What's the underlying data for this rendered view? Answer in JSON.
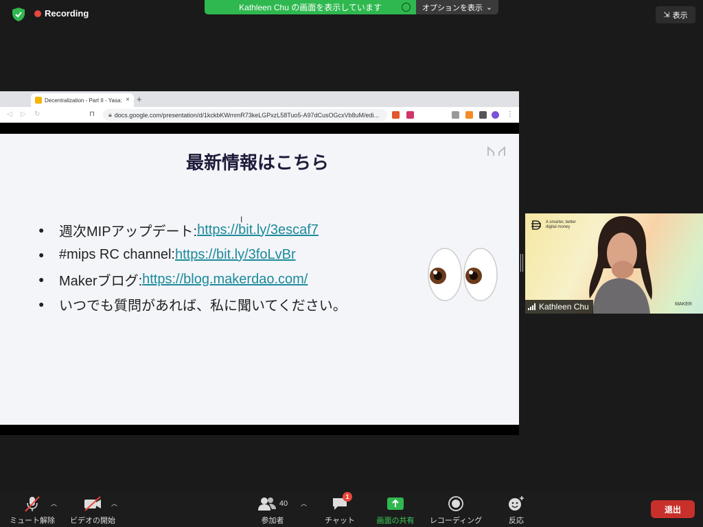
{
  "top": {
    "recording_label": "Recording",
    "share_banner": "Kathleen Chu の画面を表示しています",
    "options_label": "オプションを表示",
    "view_label": "表示"
  },
  "browser": {
    "tab_title": "Decentralization - Part II - Yasa:",
    "url": "docs.google.com/presentation/d/1kckbKWrnmR73keLGPxzL58Tuo5-A97dCusOGcxVb8uM/edi..."
  },
  "slide": {
    "title": "最新情報はこちら",
    "bullets": [
      {
        "text": "週次MIPアップデート: ",
        "link": "https://bit.ly/3escaf7"
      },
      {
        "text": "#mips RC channel: ",
        "link": "https://bit.ly/3foLvBr"
      },
      {
        "text": "Makerブログ: ",
        "link": "https://blog.makerdao.com/"
      },
      {
        "text": "いつでも質問があれば、私に聞いてください。",
        "link": ""
      }
    ]
  },
  "video": {
    "participant_name": "Kathleen Chu",
    "tagline_1": "A smarter, better",
    "tagline_2": "digital money",
    "brand": "MAKER"
  },
  "toolbar": {
    "mute_label": "ミュート解除",
    "video_label": "ビデオの開始",
    "participants_label": "参加者",
    "participants_count": "40",
    "chat_label": "チャット",
    "chat_badge": "1",
    "share_label": "画面の共有",
    "record_label": "レコーディング",
    "react_label": "反応",
    "leave_label": "退出"
  },
  "colors": {
    "accent_green": "#2fb84f",
    "recording_red": "#e8473b",
    "leave_red": "#c7302b",
    "link_teal": "#1a8a9a"
  }
}
